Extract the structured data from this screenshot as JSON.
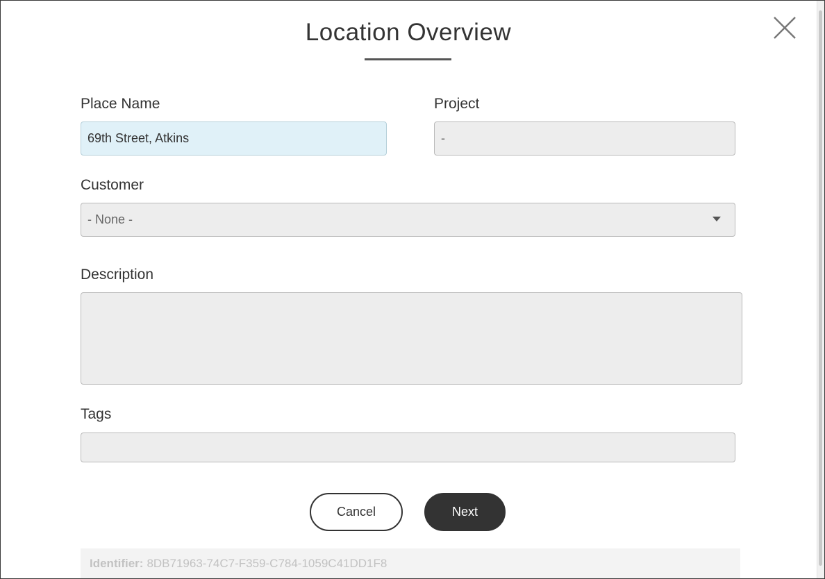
{
  "dialog": {
    "title": "Location Overview",
    "close_icon": "close-icon"
  },
  "form": {
    "place_name": {
      "label": "Place Name",
      "value": "69th Street, Atkins"
    },
    "project": {
      "label": "Project",
      "value": "-"
    },
    "customer": {
      "label": "Customer",
      "value": "- None -",
      "icon": "chevron-down-icon"
    },
    "description": {
      "label": "Description",
      "value": ""
    },
    "tags": {
      "label": "Tags",
      "value": ""
    }
  },
  "buttons": {
    "cancel": "Cancel",
    "next": "Next"
  },
  "footer": {
    "identifier_label": "Identifier:",
    "identifier_value": "8DB71963-74C7-F359-C784-1059C41DD1F8"
  },
  "colors": {
    "accent_dark": "#333333",
    "active_field_bg": "#e0f1f8",
    "field_bg": "#ededed"
  }
}
